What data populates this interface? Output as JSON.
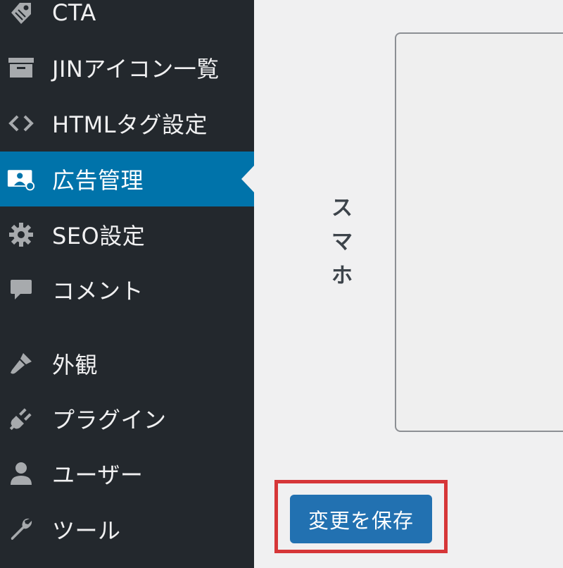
{
  "sidebar": {
    "items": [
      {
        "label": "CTA",
        "icon": "tag-icon"
      },
      {
        "label": "JINアイコン一覧",
        "icon": "archive-icon"
      },
      {
        "label": "HTMLタグ設定",
        "icon": "code-icon"
      },
      {
        "label": "広告管理",
        "icon": "ad-icon",
        "current": true
      },
      {
        "label": "SEO設定",
        "icon": "gear-icon"
      },
      {
        "label": "コメント",
        "icon": "comment-icon"
      },
      {
        "label": "外観",
        "icon": "paint-brush-icon"
      },
      {
        "label": "プラグイン",
        "icon": "plug-icon"
      },
      {
        "label": "ユーザー",
        "icon": "user-icon"
      },
      {
        "label": "ツール",
        "icon": "wrench-icon"
      }
    ]
  },
  "main": {
    "device_label": "スマホ",
    "save_button_label": "変更を保存"
  },
  "colors": {
    "sidebar_bg": "#23282d",
    "current_bg": "#0073aa",
    "button_bg": "#2271b1",
    "highlight": "#d63638",
    "page_bg": "#f0f0f1"
  }
}
